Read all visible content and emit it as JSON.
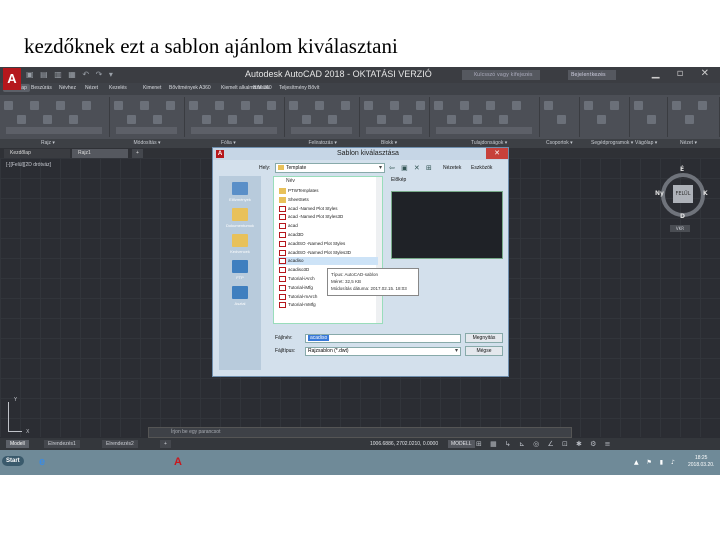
{
  "slide": {
    "heading": "kezdőknek ezt a sablon ajánlom kiválasztani"
  },
  "app": {
    "logo": "A",
    "title": "Autodesk AutoCAD 2018 - OKTATÁSI VERZIÓ",
    "search_placeholder": "Kulcsszó vagy kifejezés",
    "signin": "Bejelentkezés",
    "quick_access_icon": "quick-access-icons"
  },
  "menu_tabs": [
    "Kezdőlap",
    "Beszúrás",
    "Névhez",
    "Nézet",
    "Kezelés",
    "Kimenet",
    "Bővítmények",
    "A360",
    "Kiemelt alkalmazások",
    "BIM 360",
    "Teljesítmény",
    "Bővít"
  ],
  "ribbon_panels": [
    "Rajz",
    "Módosítás",
    "Fólia",
    "Feliratozás",
    "Blokk",
    "Tulajdonságok",
    "Csoportok",
    "Segédprogramok",
    "Vágólap",
    "Nézet"
  ],
  "file_tabs": {
    "start": "Kezdőlap",
    "document": "Rajz1",
    "add": "+"
  },
  "viewport": {
    "label": "[-][Felül][2D drótváz]",
    "viewcube": {
      "face": "FELÜL",
      "north": "É",
      "south": "D",
      "east": "K",
      "west": "Ny"
    },
    "wcs": "VKR",
    "ucs_x": "X",
    "ucs_y": "Y"
  },
  "command_line": {
    "placeholder": "Írjon be egy parancsot"
  },
  "layout_tabs": [
    "Modell",
    "Elrendezés1",
    "Elrendezés2",
    "+"
  ],
  "status": {
    "coords": "1006.6886, 2702.0210, 0.0000",
    "model": "MODELL"
  },
  "taskbar": {
    "start": "Start",
    "icons": [
      {
        "name": "ie-icon",
        "color": "#3c8be0",
        "glyph": "e"
      },
      {
        "name": "explorer-icon",
        "color": "#e8c15a",
        "glyph": ""
      },
      {
        "name": "chrome-icon",
        "color": "#d9453c",
        "glyph": ""
      },
      {
        "name": "save-icon",
        "color": "#3b5fb0",
        "glyph": ""
      },
      {
        "name": "app-icon",
        "color": "#c0302a",
        "glyph": ""
      },
      {
        "name": "autocad-icon",
        "color": "#c8181e",
        "glyph": "A"
      }
    ],
    "clock_time": "18:25",
    "clock_date": "2018.03.20."
  },
  "dialog": {
    "logo": "A",
    "title": "Sablon kiválasztása",
    "close": "✕",
    "look_in_label": "Hely:",
    "look_in_value": "Template",
    "views_label": "Nézetek",
    "tools_label": "Eszközök",
    "places": [
      {
        "label": "Előzmények",
        "color": "#5a8fc8"
      },
      {
        "label": "Dokumentumok",
        "color": "#e8c15a"
      },
      {
        "label": "Kedvencek",
        "color": "#e8c15a"
      },
      {
        "label": "FTP",
        "color": "#3f7fbf"
      },
      {
        "label": "Asztal",
        "color": "#3f7fbf"
      }
    ],
    "column_name": "Név",
    "files": [
      {
        "name": "PTWTemplates",
        "type": "folder"
      },
      {
        "name": "SheetSets",
        "type": "folder"
      },
      {
        "name": "acad -Named Plot Styles",
        "type": "dwt"
      },
      {
        "name": "acad -Named Plot Styles3D",
        "type": "dwt"
      },
      {
        "name": "acad",
        "type": "dwt"
      },
      {
        "name": "acad3D",
        "type": "dwt"
      },
      {
        "name": "acadISO -Named Plot Styles",
        "type": "dwt"
      },
      {
        "name": "acadISO -Named Plot Styles3D",
        "type": "dwt"
      },
      {
        "name": "acadiso",
        "type": "dwt",
        "selected": true
      },
      {
        "name": "acadiso3D",
        "type": "dwt"
      },
      {
        "name": "Tutorial-iArch",
        "type": "dwt"
      },
      {
        "name": "Tutorial-iMfg",
        "type": "dwt"
      },
      {
        "name": "Tutorial-mArch",
        "type": "dwt"
      },
      {
        "name": "Tutorial-mMfg",
        "type": "dwt"
      }
    ],
    "tooltip": {
      "line1": "Típus: AutoCAD-sablon",
      "line2": "Méret: 32,5 KB",
      "line3": "Módosítás dátuma: 2017.02.15. 18:03"
    },
    "preview_label": "Előkép",
    "filename_label": "Fájlnév:",
    "filename_value": "acadiso",
    "filetype_label": "Fájltípus:",
    "filetype_value": "Rajzsablon (*.dwt)",
    "open_button": "Megnyitás",
    "cancel_button": "Mégse"
  },
  "colors": {
    "autocad_red": "#b5171c",
    "selection_blue": "#cde3f7"
  }
}
